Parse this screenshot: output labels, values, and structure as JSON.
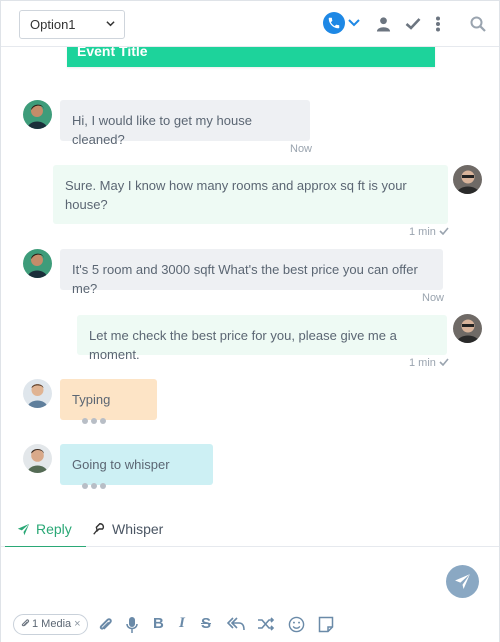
{
  "header": {
    "select_value": "Option1",
    "icons": [
      "phone-icon",
      "chevron-down-icon",
      "user-icon",
      "check-icon",
      "more-vertical-icon",
      "search-icon"
    ]
  },
  "event": {
    "title": "Event Title"
  },
  "messages": [
    {
      "direction": "in",
      "text": "Hi, I would like to get my house cleaned?",
      "time": "Now"
    },
    {
      "direction": "out",
      "text": "Sure. May I know how many rooms and approx sq ft is your house?",
      "time": "1 min"
    },
    {
      "direction": "in",
      "text": "It's 5 room and 3000 sqft What's the best price you can offer me?",
      "time": "Now"
    },
    {
      "direction": "out",
      "text": "Let me check the best price for you, please give me a moment.",
      "time": "1 min"
    },
    {
      "direction": "in",
      "text": "Typing",
      "kind": "typing"
    },
    {
      "direction": "in",
      "text": "Going to whisper",
      "kind": "whisper"
    }
  ],
  "tabs": [
    {
      "label": "Reply",
      "active": true
    },
    {
      "label": "Whisper",
      "active": false
    }
  ],
  "composer": {
    "media_chip": "1 Media",
    "media_remove": "×",
    "toolbar_icons": [
      "attach-icon",
      "microphone-icon",
      "bold-icon",
      "italic-icon",
      "strikethrough-icon",
      "reply-all-icon",
      "shuffle-icon",
      "emoji-icon",
      "note-icon"
    ],
    "bold": "B",
    "italic": "I",
    "strike": "S"
  },
  "colors": {
    "accent_green": "#1dd39b",
    "tab_active": "#2aa876",
    "phone_blue": "#1e88e5",
    "send_button": "#8aa8c3",
    "incoming_bubble": "#eef0f3",
    "outgoing_bubble": "#eefaf4",
    "typing_bubble": "#fde4c6",
    "whisper_bubble": "#cdf0f4"
  }
}
